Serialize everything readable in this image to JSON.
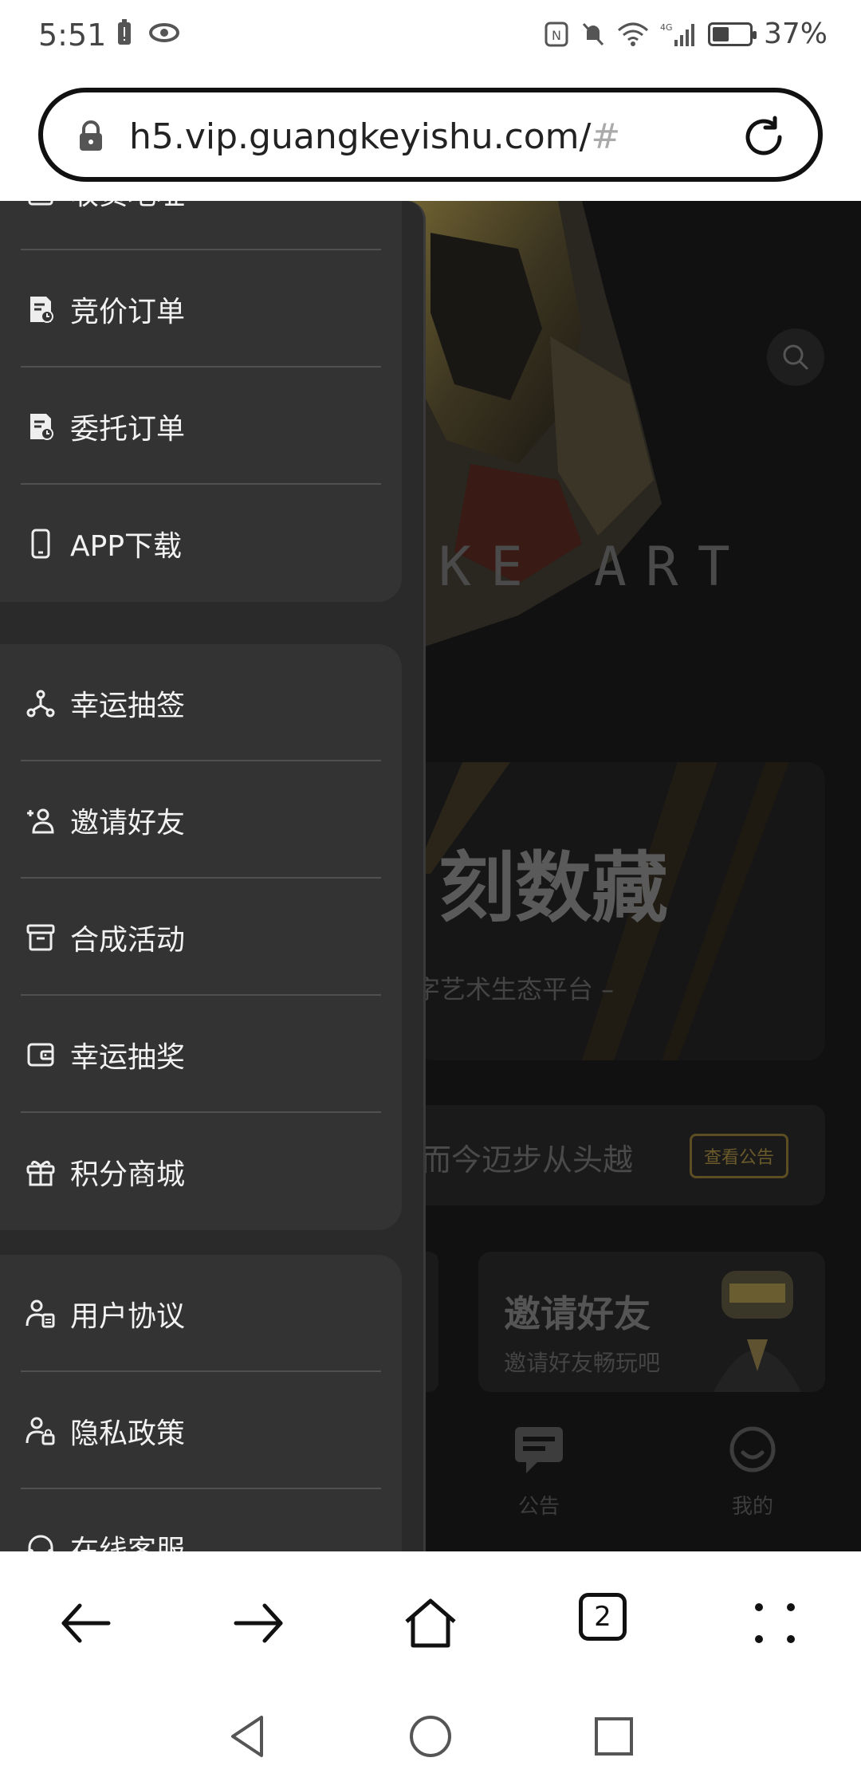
{
  "status_bar": {
    "time": "5:51",
    "battery": "37%",
    "icons": [
      "battery-alert-icon",
      "eye-icon",
      "nfc-icon",
      "mute-icon",
      "wifi-icon",
      "signal-4g-icon",
      "battery-icon"
    ]
  },
  "url_bar": {
    "url": "h5.vip.guangkeyishu.com/",
    "hash": "#"
  },
  "drawer": {
    "groups": [
      {
        "items": [
          {
            "label": "收货地址",
            "icon": "address-icon"
          },
          {
            "label": "竞价订单",
            "icon": "order-icon"
          },
          {
            "label": "委托订单",
            "icon": "order-icon"
          },
          {
            "label": "APP下载",
            "icon": "phone-icon"
          }
        ]
      },
      {
        "items": [
          {
            "label": "幸运抽签",
            "icon": "share-node-icon"
          },
          {
            "label": "邀请好友",
            "icon": "add-user-icon"
          },
          {
            "label": "合成活动",
            "icon": "archive-icon"
          },
          {
            "label": "幸运抽奖",
            "icon": "wallet-icon"
          },
          {
            "label": "积分商城",
            "icon": "gift-icon"
          }
        ]
      },
      {
        "items": [
          {
            "label": "用户协议",
            "icon": "user-doc-icon"
          },
          {
            "label": "隐私政策",
            "icon": "user-lock-icon"
          },
          {
            "label": "在线客服",
            "icon": "headset-icon"
          }
        ]
      }
    ]
  },
  "background_page": {
    "brand_text": "KE ART",
    "banner_title": "刻数藏",
    "banner_subtitle": "字艺术生态平台 –",
    "notice_text": "而今迈步从头越",
    "notice_button": "查看公告",
    "invite_title": "邀请好友",
    "invite_subtitle": "邀请好友畅玩吧",
    "tabs": [
      {
        "label": "公告",
        "icon": "notice-icon"
      },
      {
        "label": "我的",
        "icon": "profile-icon"
      }
    ]
  },
  "browser_nav": {
    "tab_count": "2"
  },
  "colors": {
    "drawer_bg": "#2a2a2a",
    "group_bg": "#333333",
    "accent_gold": "#6b5a2a"
  }
}
